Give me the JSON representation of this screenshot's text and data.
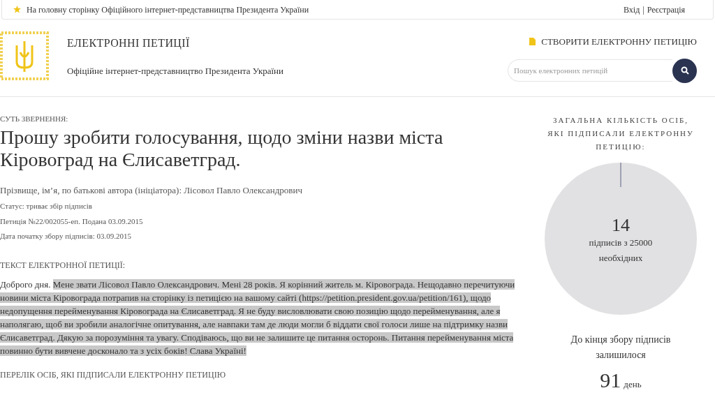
{
  "top_bar": {
    "home_link": "На головну сторінку Офіційного інтернет-представництва Президента України",
    "login": "Вхід",
    "separator": "|",
    "register": "Реєстрація"
  },
  "header": {
    "title": "ЕЛЕКТРОННІ ПЕТИЦІЇ",
    "subtitle": "Офіційне інтернет-представництво Президента України",
    "create_link": "СТВОРИТИ ЕЛЕКТРОННУ ПЕТИЦІЮ",
    "search": {
      "placeholder": "Пошук електронних петицій"
    }
  },
  "petition": {
    "subject_label": "СУТЬ ЗВЕРНЕННЯ:",
    "title": "Прошу зробити голосування, щодо зміни назви міста Кіровоград на Єлисаветград.",
    "meta": [
      "Прізвище, ім’я, по батькові автора (ініціатора): Лісовол Павло Олександрович",
      "Статус: триває збір підписів",
      "Петиція №22/002055-еп. Подана 03.09.2015",
      "Дата початку збору підписів: 03.09.2015"
    ],
    "text_label": "ТЕКСТ ЕЛЕКТРОННОЇ ПЕТИЦІЇ:",
    "text": [
      {
        "text": "Доброго дня. ",
        "selected": false
      },
      {
        "text": "Мене звати Лісовол Павло Олександрович. Мені 28 років. Я корінний житель м. Кіровограда. Нещодавно перечитуючи новини міста Кіровограда потрапив на сторінку із петицією на вашому сайті (https://petition.president.gov.ua/petition/161), щодо недопущення перейменування Кіровограда на Єлисаветград. Я не буду висловлювати свою позицію щодо перейменування, але я наполягаю, щоб ви зробили аналогічне опитування, але навпаки там де люди могли б віддати свої голоси лише на підтримку назви Єлисаветград. Дякую за порозуміння та увагу. Сподіваюсь, що ви не залишите це питання осторонь. Питання перейменування міста повинно бути вивчене досконало та з усіх боків! Слава Україні!",
        "selected": true
      }
    ],
    "signers_label": "ПЕРЕЛІК ОСІБ, ЯКІ ПІДПИСАЛИ ЕЛЕКТРОННУ ПЕТИЦІЮ"
  },
  "sidebar": {
    "heading": "ЗАГАЛЬНА КІЛЬКІСТЬ ОСІБ, ЯКІ ПІДПИСАЛИ ЕЛЕКТРОННУ ПЕТИЦІЮ:",
    "progress": {
      "count": "14",
      "caption": "підписів з 25000 необхідних"
    },
    "remaining_label": "До кінця збору підписів залишилося",
    "days": "91",
    "days_unit": "день"
  }
}
